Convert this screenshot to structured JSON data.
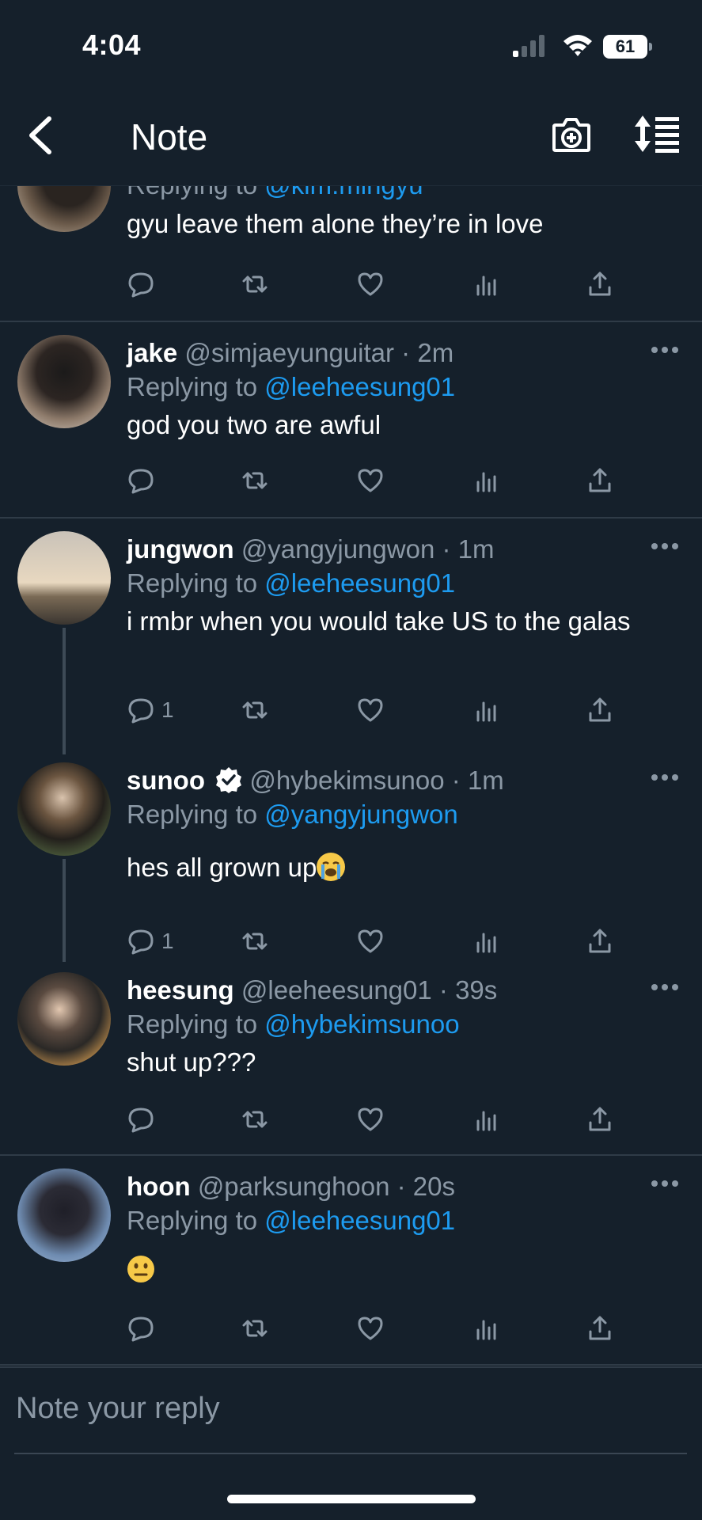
{
  "status_bar": {
    "time": "4:04",
    "battery": "61"
  },
  "nav": {
    "title": "Note"
  },
  "tweets": [
    {
      "name": "",
      "handle": "",
      "time": "",
      "replying_prefix": "Replying to ",
      "replying_to": "@kim.mingyu",
      "text": "gyu leave them alone they’re in love",
      "reply_count": ""
    },
    {
      "name": "jake",
      "handle": "@simjaeyunguitar · 2m",
      "replying_prefix": "Replying to ",
      "replying_to": "@leeheesung01",
      "text": "god you two are awful",
      "reply_count": ""
    },
    {
      "name": "jungwon",
      "handle": "@yangyjungwon · 1m",
      "replying_prefix": "Replying to ",
      "replying_to": "@leeheesung01",
      "text": "i rmbr when you would take US to the galas",
      "reply_count": "1"
    },
    {
      "name": "sunoo",
      "handle": "@hybekimsunoo · 1m",
      "replying_prefix": "Replying to ",
      "replying_to": "@yangyjungwon",
      "text": "hes all grown up",
      "reply_count": "1"
    },
    {
      "name": "heesung",
      "handle": "@leeheesung01 · 39s",
      "replying_prefix": "Replying to ",
      "replying_to": "@hybekimsunoo",
      "text": "shut up???",
      "reply_count": ""
    },
    {
      "name": "hoon",
      "handle": "@parksunghoon · 20s",
      "replying_prefix": "Replying to ",
      "replying_to": "@leeheesung01",
      "text": "",
      "reply_count": ""
    }
  ],
  "composer": {
    "placeholder": "Note your reply"
  },
  "icons": {
    "reply": "reply-icon",
    "retweet": "retweet-icon",
    "like": "heart-icon",
    "views": "views-icon",
    "share": "share-icon",
    "more": "more-icon",
    "back": "back-arrow-icon",
    "camera": "camera-add-icon",
    "sort": "sort-icon",
    "verified": "verified-icon"
  },
  "colors": {
    "background": "#15202b",
    "mention": "#1d9bf0",
    "muted": "#8b98a5",
    "divider": "#2f3b47"
  }
}
